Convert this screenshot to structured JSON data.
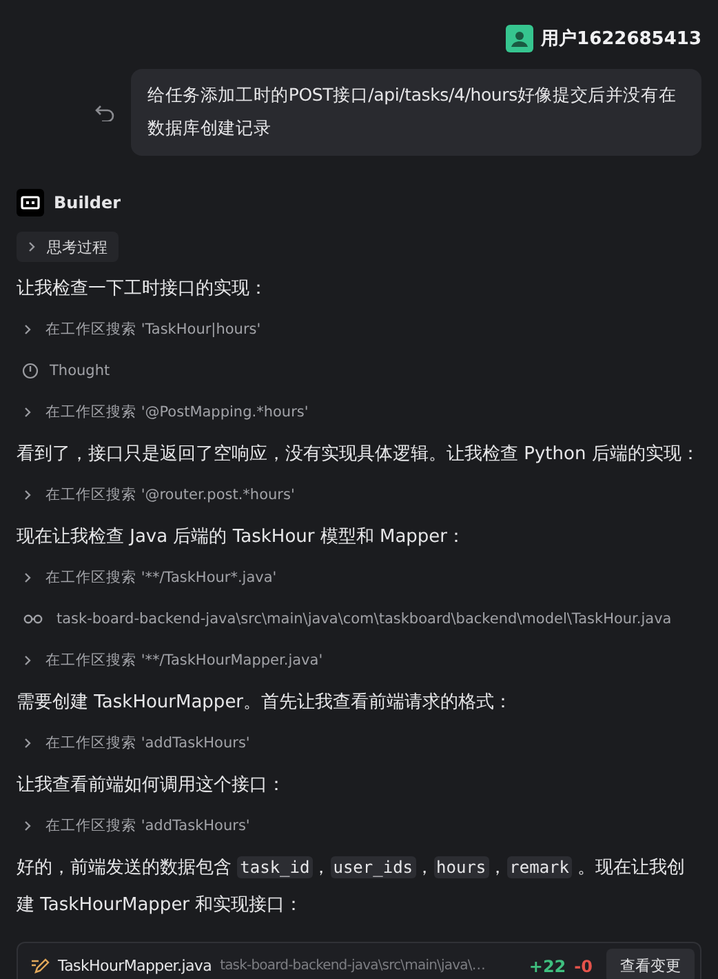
{
  "user": {
    "name": "用户1622685413",
    "message": "给任务添加工时的POST接口/api/tasks/4/hours好像提交后并没有在数据库创建记录"
  },
  "agent": {
    "name": "Builder",
    "thinking": {
      "label": "思考过程",
      "expanded": false
    }
  },
  "steps": [
    {
      "kind": "paragraph",
      "segments": [
        {
          "kind": "text",
          "text": "让我检查一下工时接口的实现："
        }
      ]
    },
    {
      "kind": "search",
      "text": "在工作区搜索 'TaskHour|hours'"
    },
    {
      "kind": "thought",
      "text": "Thought"
    },
    {
      "kind": "search",
      "text": "在工作区搜索 '@PostMapping.*hours'"
    },
    {
      "kind": "paragraph",
      "segments": [
        {
          "kind": "text",
          "text": "看到了，接口只是返回了空响应，没有实现具体逻辑。让我检查 Python 后端的实现："
        }
      ]
    },
    {
      "kind": "search",
      "text": "在工作区搜索 '@router.post.*hours'"
    },
    {
      "kind": "paragraph",
      "segments": [
        {
          "kind": "text",
          "text": "现在让我检查 Java 后端的 TaskHour 模型和 Mapper："
        }
      ]
    },
    {
      "kind": "search",
      "text": "在工作区搜索 '**/TaskHour*.java'"
    },
    {
      "kind": "file",
      "text": "task-board-backend-java\\src\\main\\java\\com\\taskboard\\backend\\model\\TaskHour.java"
    },
    {
      "kind": "search",
      "text": "在工作区搜索 '**/TaskHourMapper.java'"
    },
    {
      "kind": "paragraph",
      "segments": [
        {
          "kind": "text",
          "text": "需要创建 TaskHourMapper。首先让我查看前端请求的格式："
        }
      ]
    },
    {
      "kind": "search",
      "text": "在工作区搜索 'addTaskHours'"
    },
    {
      "kind": "paragraph",
      "segments": [
        {
          "kind": "text",
          "text": "让我查看前端如何调用这个接口："
        }
      ]
    },
    {
      "kind": "search",
      "text": "在工作区搜索 'addTaskHours'"
    },
    {
      "kind": "paragraph",
      "segments": [
        {
          "kind": "text",
          "text": "好的，前端发送的数据包含 "
        },
        {
          "kind": "code",
          "text": "task_id"
        },
        {
          "kind": "text",
          "text": "，"
        },
        {
          "kind": "code",
          "text": "user_ids"
        },
        {
          "kind": "text",
          "text": "，"
        },
        {
          "kind": "code",
          "text": "hours"
        },
        {
          "kind": "text",
          "text": "，"
        },
        {
          "kind": "code",
          "text": "remark"
        },
        {
          "kind": "text",
          "text": " 。现在让我创建 TaskHourMapper 和实现接口："
        }
      ]
    }
  ],
  "change_card": {
    "file": "TaskHourMapper.java",
    "path": "task-board-backend-java\\src\\main\\java\\…",
    "added": "+22",
    "removed": "-0",
    "button": "查看变更"
  }
}
